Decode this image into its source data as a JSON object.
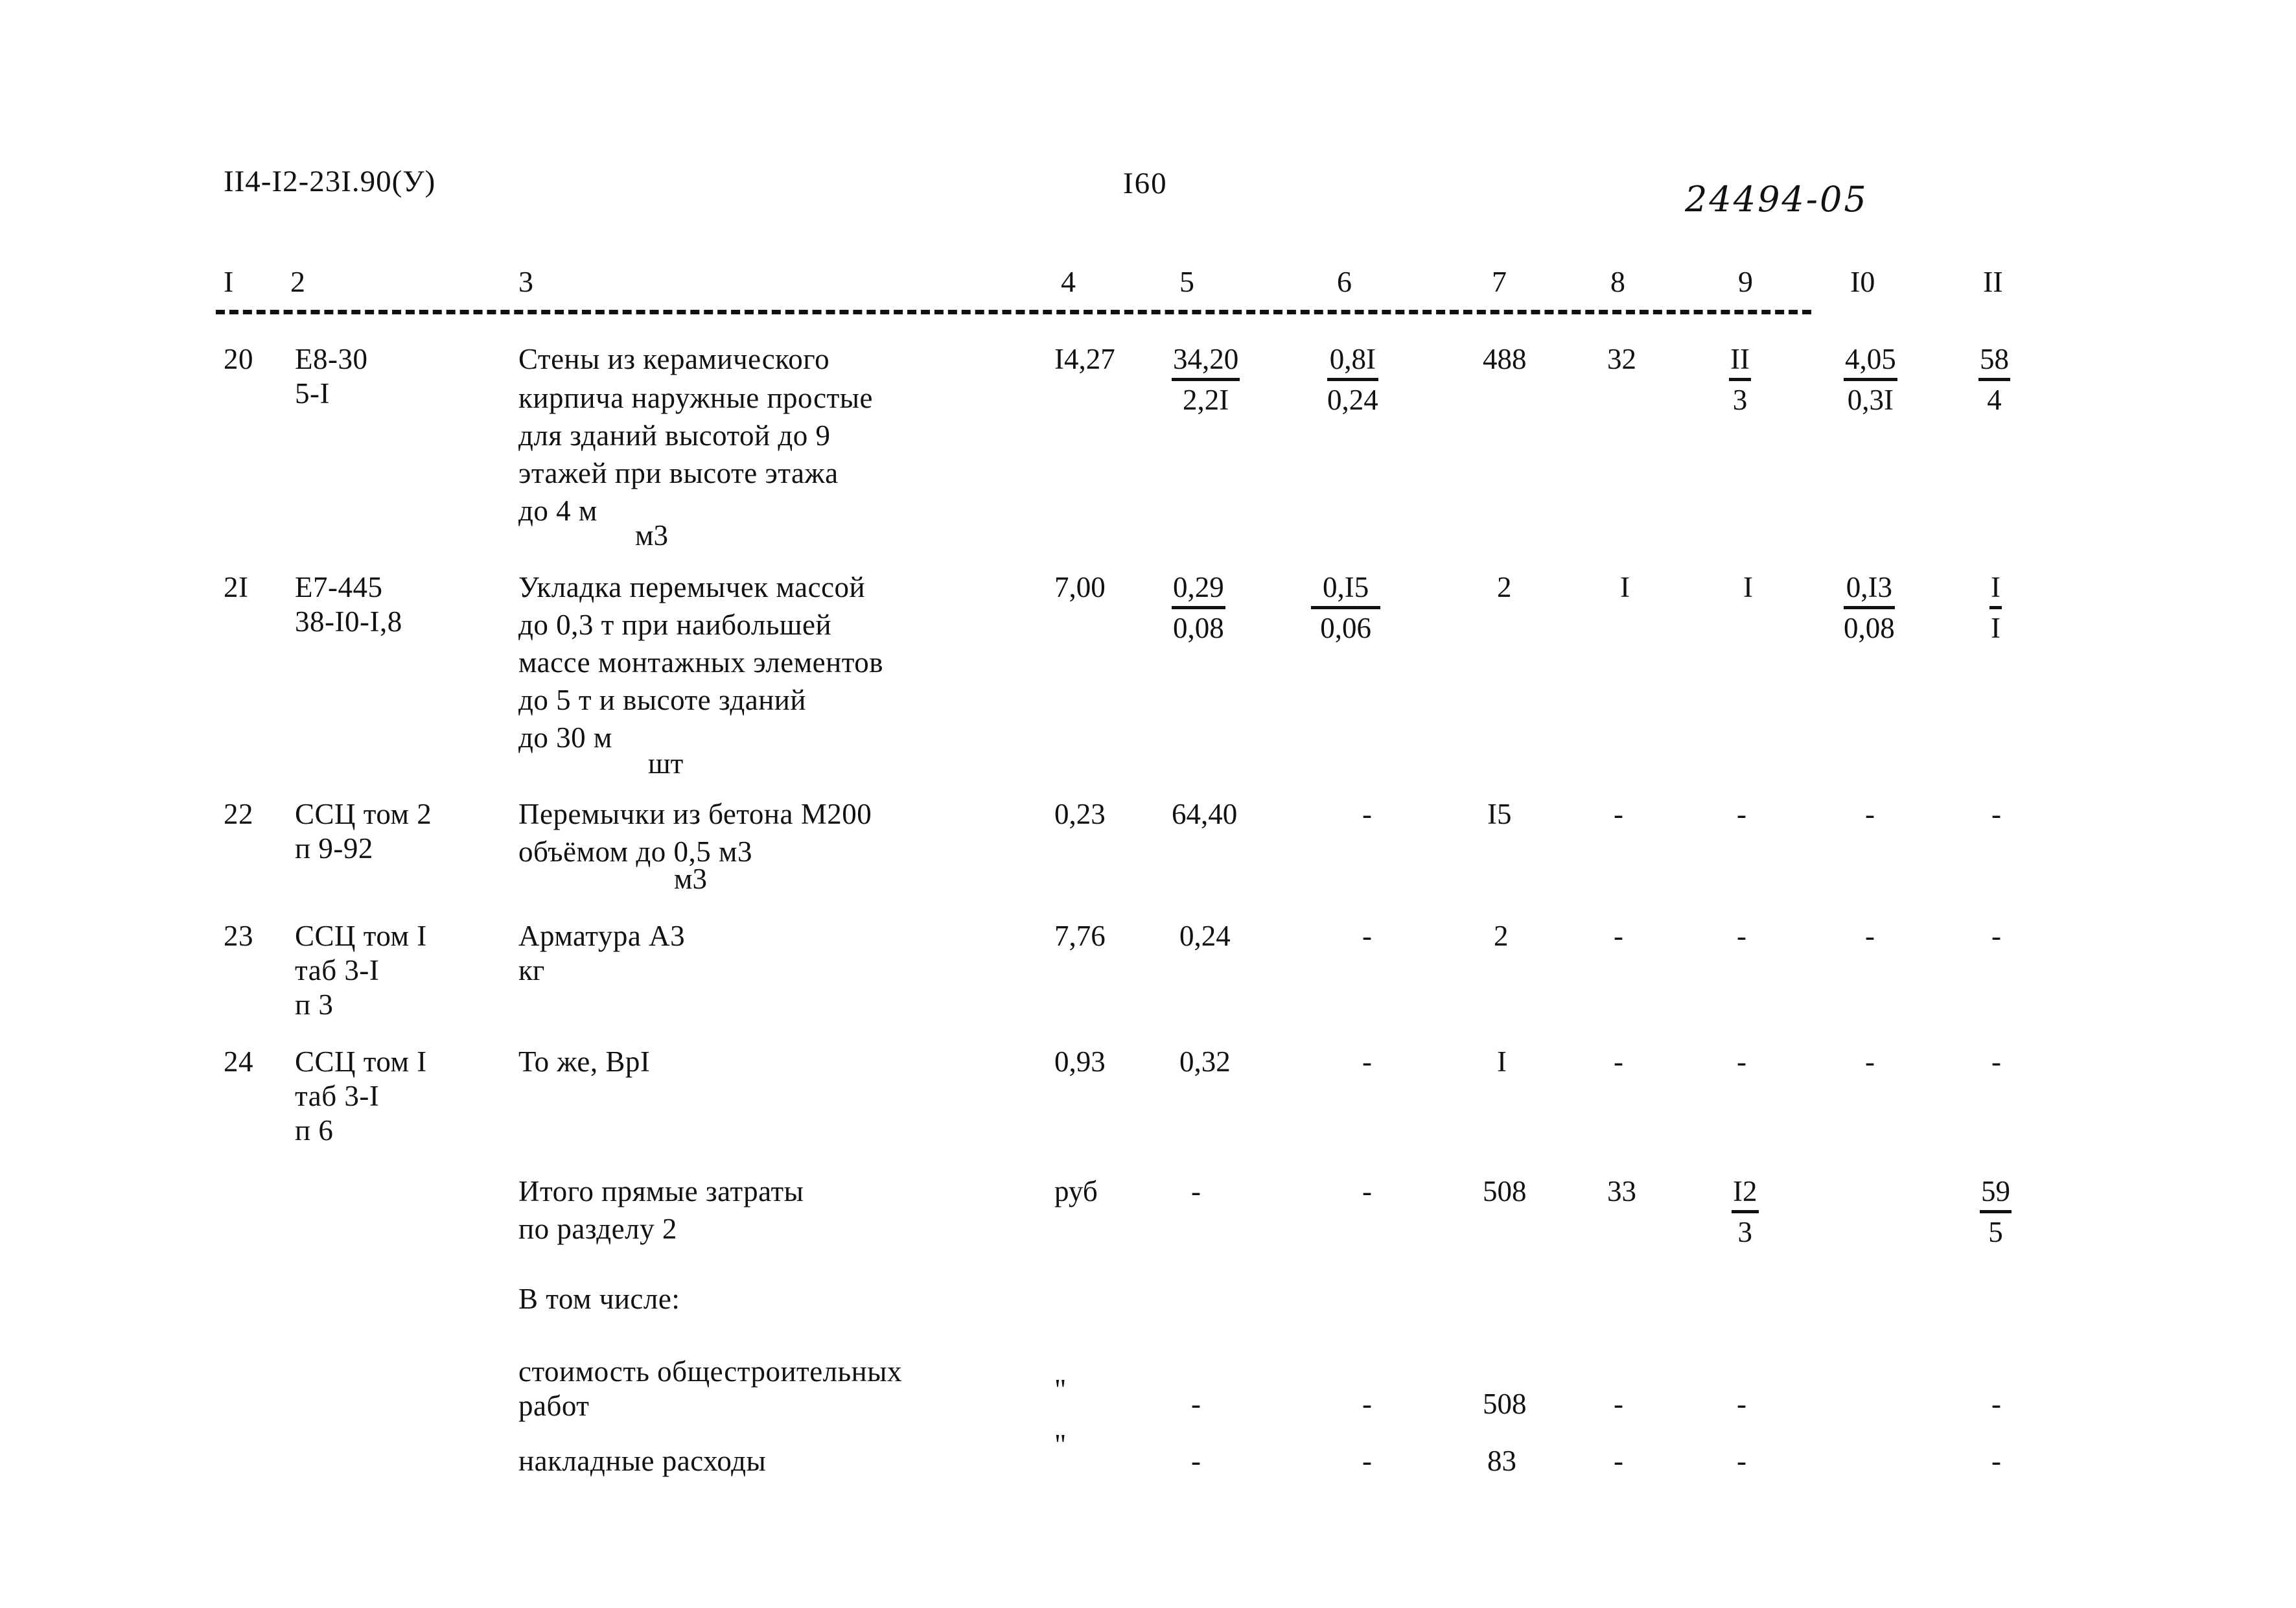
{
  "header": {
    "doc_code": "II4-I2-23I.90(У)",
    "page_number": "I60",
    "archive_code": "24494-05"
  },
  "table": {
    "column_headers": [
      "I",
      "2",
      "3",
      "4",
      "5",
      "6",
      "7",
      "8",
      "9",
      "I0",
      "II"
    ],
    "rows": [
      {
        "no": "20",
        "ref_lines": [
          "E8-30",
          "5-I"
        ],
        "description_lines": [
          "Стены из керамического",
          "кирпича наружные простые",
          "для зданий высотой до 9",
          "этажей при высоте этажа",
          "до 4 м"
        ],
        "unit": "м3",
        "c4": "I4,27",
        "c5_top": "34,20",
        "c5_bot": "2,2I",
        "c6_top": "0,8I",
        "c6_bot": "0,24",
        "c7": "488",
        "c8": "32",
        "c9_top": "II",
        "c9_bot": "3",
        "c10_top": "4,05",
        "c10_bot": "0,3I",
        "c11_top": "58",
        "c11_bot": "4"
      },
      {
        "no": "2I",
        "ref_lines": [
          "E7-445",
          "38-I0-I,8"
        ],
        "description_lines": [
          "Укладка перемычек массой",
          "до 0,3 т при наибольшей",
          "массе монтажных элементов",
          "до 5 т и высоте зданий",
          "до 30 м"
        ],
        "unit": "шт",
        "c4": "7,00",
        "c5_top": "0,29",
        "c5_bot": "0,08",
        "c6_top": "0,I5",
        "c6_bot": "0,06",
        "c7": "2",
        "c8": "I",
        "c9": "I",
        "c10_top": "0,I3",
        "c10_bot": "0,08",
        "c11_top": "I",
        "c11_bot": "I"
      },
      {
        "no": "22",
        "ref_lines": [
          "ССЦ том 2",
          "п 9-92"
        ],
        "description_lines": [
          "Перемычки из бетона М200",
          "объёмом до 0,5 м3"
        ],
        "unit": "м3",
        "c4": "0,23",
        "c5": "64,40",
        "c6": "-",
        "c7": "I5",
        "c8": "-",
        "c9": "-",
        "c10": "-",
        "c11": "-"
      },
      {
        "no": "23",
        "ref_lines": [
          "ССЦ том I",
          "таб 3-I",
          "п 3"
        ],
        "description_lines": [
          "Арматура А3"
        ],
        "unit": "кг",
        "c4": "7,76",
        "c5": "0,24",
        "c6": "-",
        "c7": "2",
        "c8": "-",
        "c9": "-",
        "c10": "-",
        "c11": "-"
      },
      {
        "no": "24",
        "ref_lines": [
          "ССЦ том I",
          "таб 3-I",
          "п 6"
        ],
        "description_lines": [
          "То же, ВрI"
        ],
        "unit": "",
        "c4": "0,93",
        "c5": "0,32",
        "c6": "-",
        "c7": "I",
        "c8": "-",
        "c9": "-",
        "c10": "-",
        "c11": "-"
      }
    ],
    "totals": {
      "label_line1": "Итого прямые затраты",
      "label_line2": "по разделу 2",
      "unit": "руб",
      "c5": "-",
      "c6": "-",
      "c7": "508",
      "c8": "33",
      "c9_top": "I2",
      "c9_bot": "3",
      "c11_top": "59",
      "c11_bot": "5"
    },
    "breakdown_heading": "В том числе:",
    "breakdown": [
      {
        "label_line1": "стоимость общестроительных",
        "label_line2": "работ",
        "unit": "\"",
        "c5": "-",
        "c6": "-",
        "c7": "508",
        "c8": "-",
        "c9": "-",
        "c11": "-"
      },
      {
        "label_line1": "накладные расходы",
        "label_line2": "",
        "unit": "\"",
        "c5": "-",
        "c6": "-",
        "c7": "83",
        "c8": "-",
        "c9": "-",
        "c11": "-"
      }
    ]
  }
}
